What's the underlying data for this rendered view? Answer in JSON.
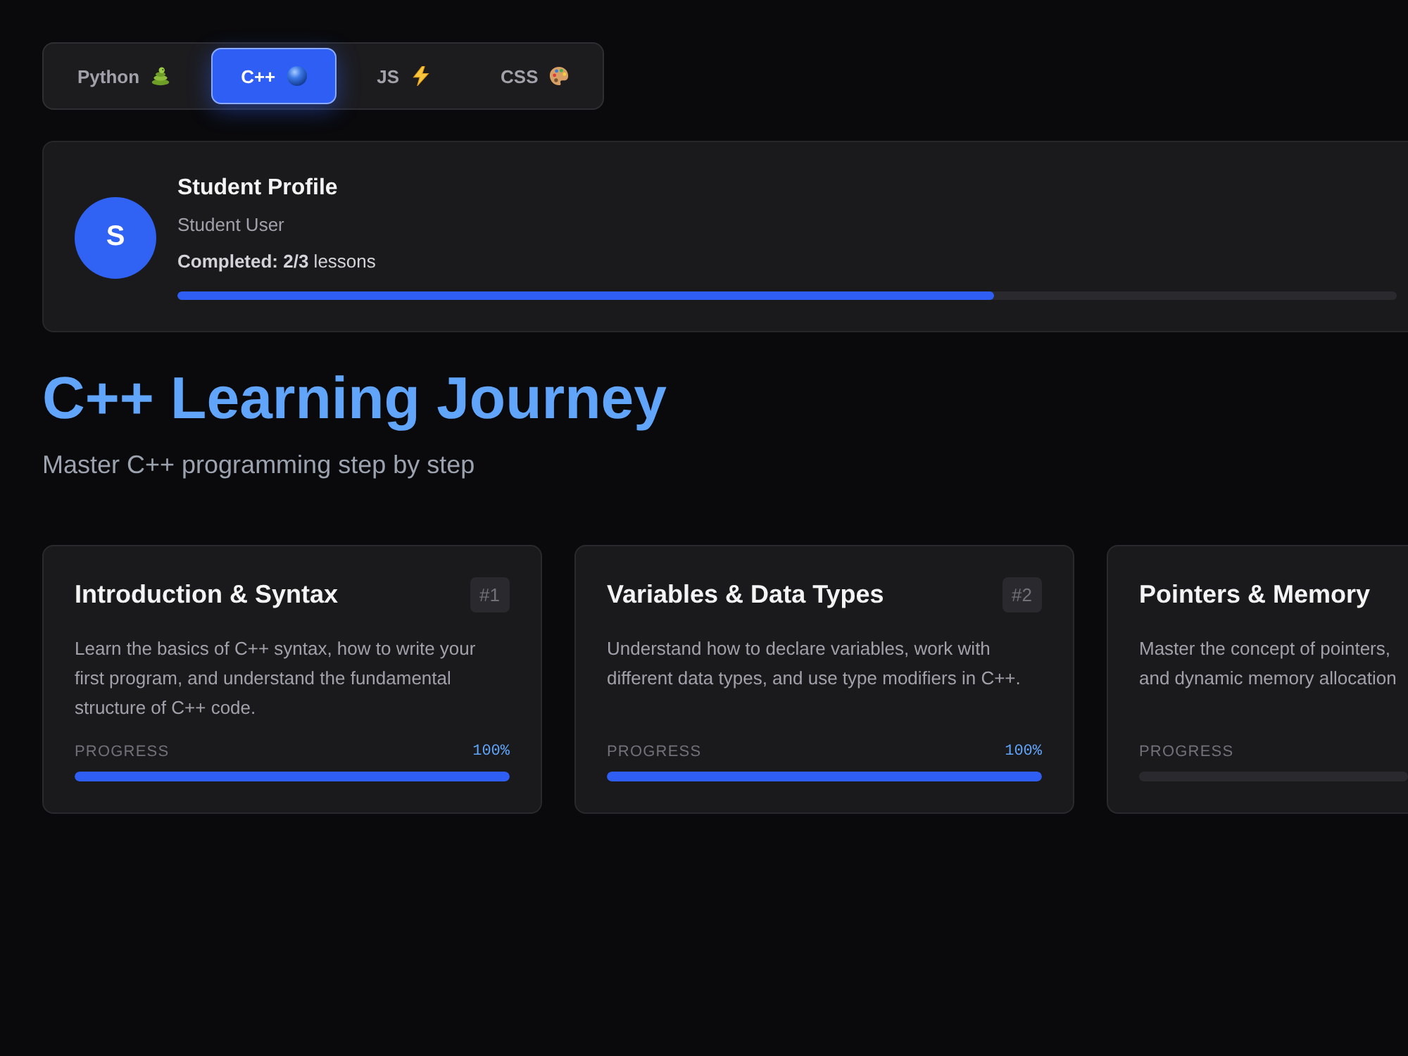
{
  "tabs": [
    {
      "label": "Python",
      "kind": "snake",
      "selected": false
    },
    {
      "label": "C++",
      "kind": "ball",
      "selected": true
    },
    {
      "label": "JS",
      "kind": "bolt",
      "selected": false
    },
    {
      "label": "CSS",
      "kind": "palette",
      "selected": false
    }
  ],
  "profile": {
    "avatar": "S",
    "title": "Student Profile",
    "name": "Student User",
    "completed": "**Completed: 2/3** lessons",
    "level": 0.67
  },
  "heading": "C++ Learning Journey",
  "subtitle": "Master C++ programming step by step",
  "lessons": [
    {
      "title": "Introduction & Syntax",
      "number": "#1",
      "description_lines": [
        "Learn the basics of C++ syntax, how to write your",
        "first program, and understand the fundamental",
        "structure of C++ code."
      ],
      "progress_label": "PROGRESS",
      "percent": "100%",
      "level": 1
    },
    {
      "title": "Variables & Data Types",
      "number": "#2",
      "description_lines": [
        "Understand how to declare variables, work with",
        "different data types, and use type modifiers in C++."
      ],
      "progress_label": "PROGRESS",
      "percent": "100%",
      "level": 1
    },
    {
      "title": "Pointers & Memory",
      "description_lines": [
        "Master the concept of pointers,",
        "and dynamic memory allocation"
      ],
      "progress_label": "PROGRESS",
      "level": 0
    }
  ]
}
